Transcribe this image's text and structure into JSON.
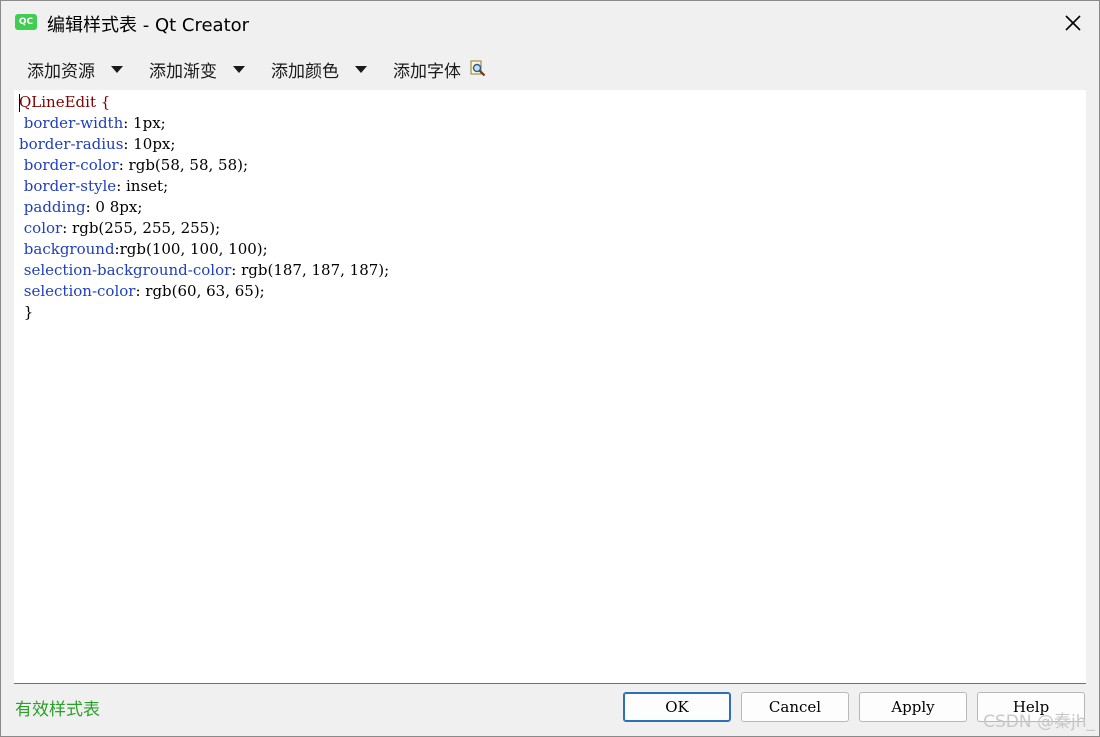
{
  "window": {
    "title": "编辑样式表 - Qt Creator",
    "app_icon_text": "QC"
  },
  "toolbar": {
    "items": [
      {
        "label": "添加资源",
        "has_dropdown": true
      },
      {
        "label": "添加渐变",
        "has_dropdown": true
      },
      {
        "label": "添加颜色",
        "has_dropdown": true
      },
      {
        "label": "添加字体",
        "has_dropdown": false
      }
    ],
    "preview_icon": "magnifier-icon"
  },
  "editor": {
    "lines": [
      {
        "selector": "QLineEdit {"
      },
      {
        "indent": " ",
        "prop": "border-width",
        "value": ": 1px;"
      },
      {
        "indent": "",
        "prop": "border-radius",
        "value": ": 10px;"
      },
      {
        "indent": " ",
        "prop": "border-color",
        "value": ": rgb(58, 58, 58);"
      },
      {
        "indent": " ",
        "prop": "border-style",
        "value": ": inset;"
      },
      {
        "indent": " ",
        "prop": "padding",
        "value": ": 0 8px;"
      },
      {
        "indent": " ",
        "prop": "color",
        "value": ": rgb(255, 255, 255);"
      },
      {
        "indent": " ",
        "prop": "background",
        "value": ":rgb(100, 100, 100);"
      },
      {
        "indent": " ",
        "prop": "selection-background-color",
        "value": ": rgb(187, 187, 187);"
      },
      {
        "indent": " ",
        "prop": "selection-color",
        "value": ": rgb(60, 63, 65);"
      },
      {
        "selector": " }"
      }
    ]
  },
  "status": {
    "text": "有效样式表"
  },
  "buttons": {
    "ok": "OK",
    "cancel": "Cancel",
    "apply": "Apply",
    "help": "Help"
  },
  "watermark": "CSDN @秦jh_",
  "colors": {
    "selector": "#800000",
    "property": "#1f3fbf",
    "status_ok": "#2aa02a",
    "focus_border": "#2e6fb8"
  }
}
